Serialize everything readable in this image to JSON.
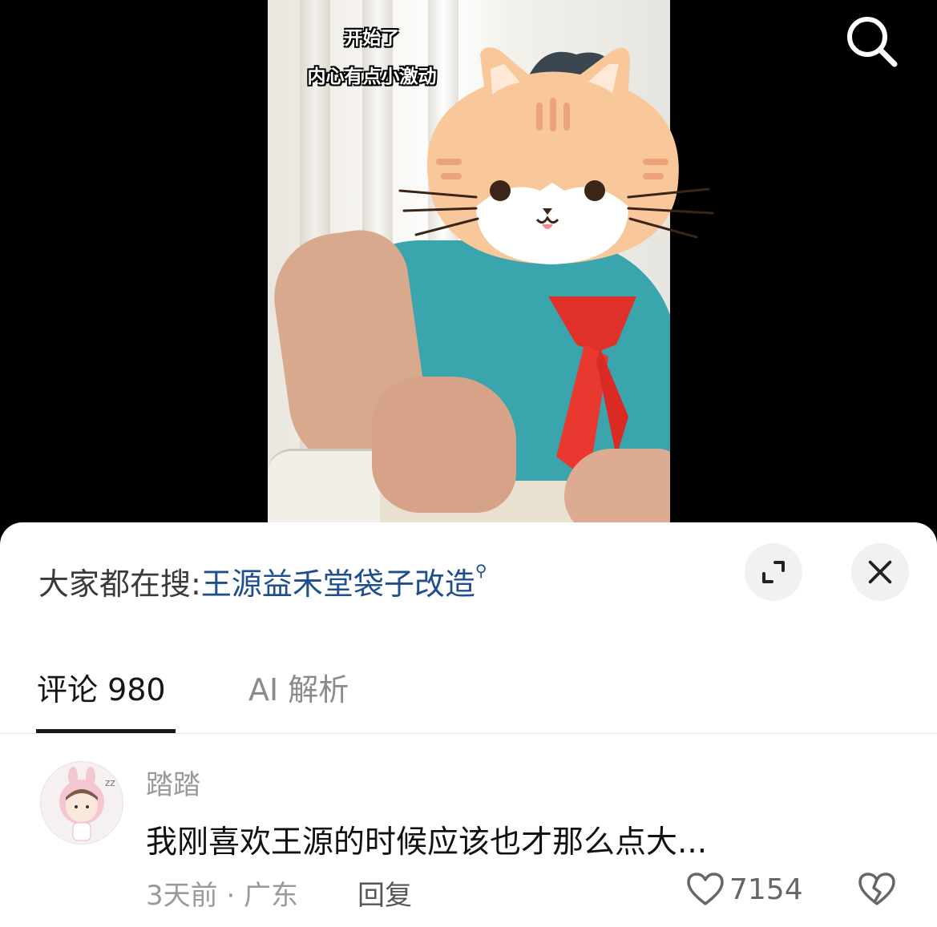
{
  "video": {
    "subtitle_line1": "开始了",
    "subtitle_line2": "内心有点小激动"
  },
  "icons": {
    "search": "search-icon",
    "expand": "expand-icon",
    "close": "close-icon",
    "heart": "heart-icon",
    "broken_heart": "broken-heart-icon"
  },
  "hot_search": {
    "label": "大家都在搜:",
    "term": "王源益禾堂袋子改造"
  },
  "tabs": [
    {
      "label": "评论 980",
      "active": true
    },
    {
      "label": "AI 解析",
      "active": false
    }
  ],
  "comments": [
    {
      "username": "踏踏",
      "text": "我刚喜欢王源的时候应该也才那么点大...",
      "meta": "3天前 · 广东",
      "reply_label": "回复",
      "likes": "7154"
    }
  ],
  "colors": {
    "accent_link": "#1e4f8c",
    "panel_bg": "#ffffff",
    "video_bg": "#000000"
  }
}
